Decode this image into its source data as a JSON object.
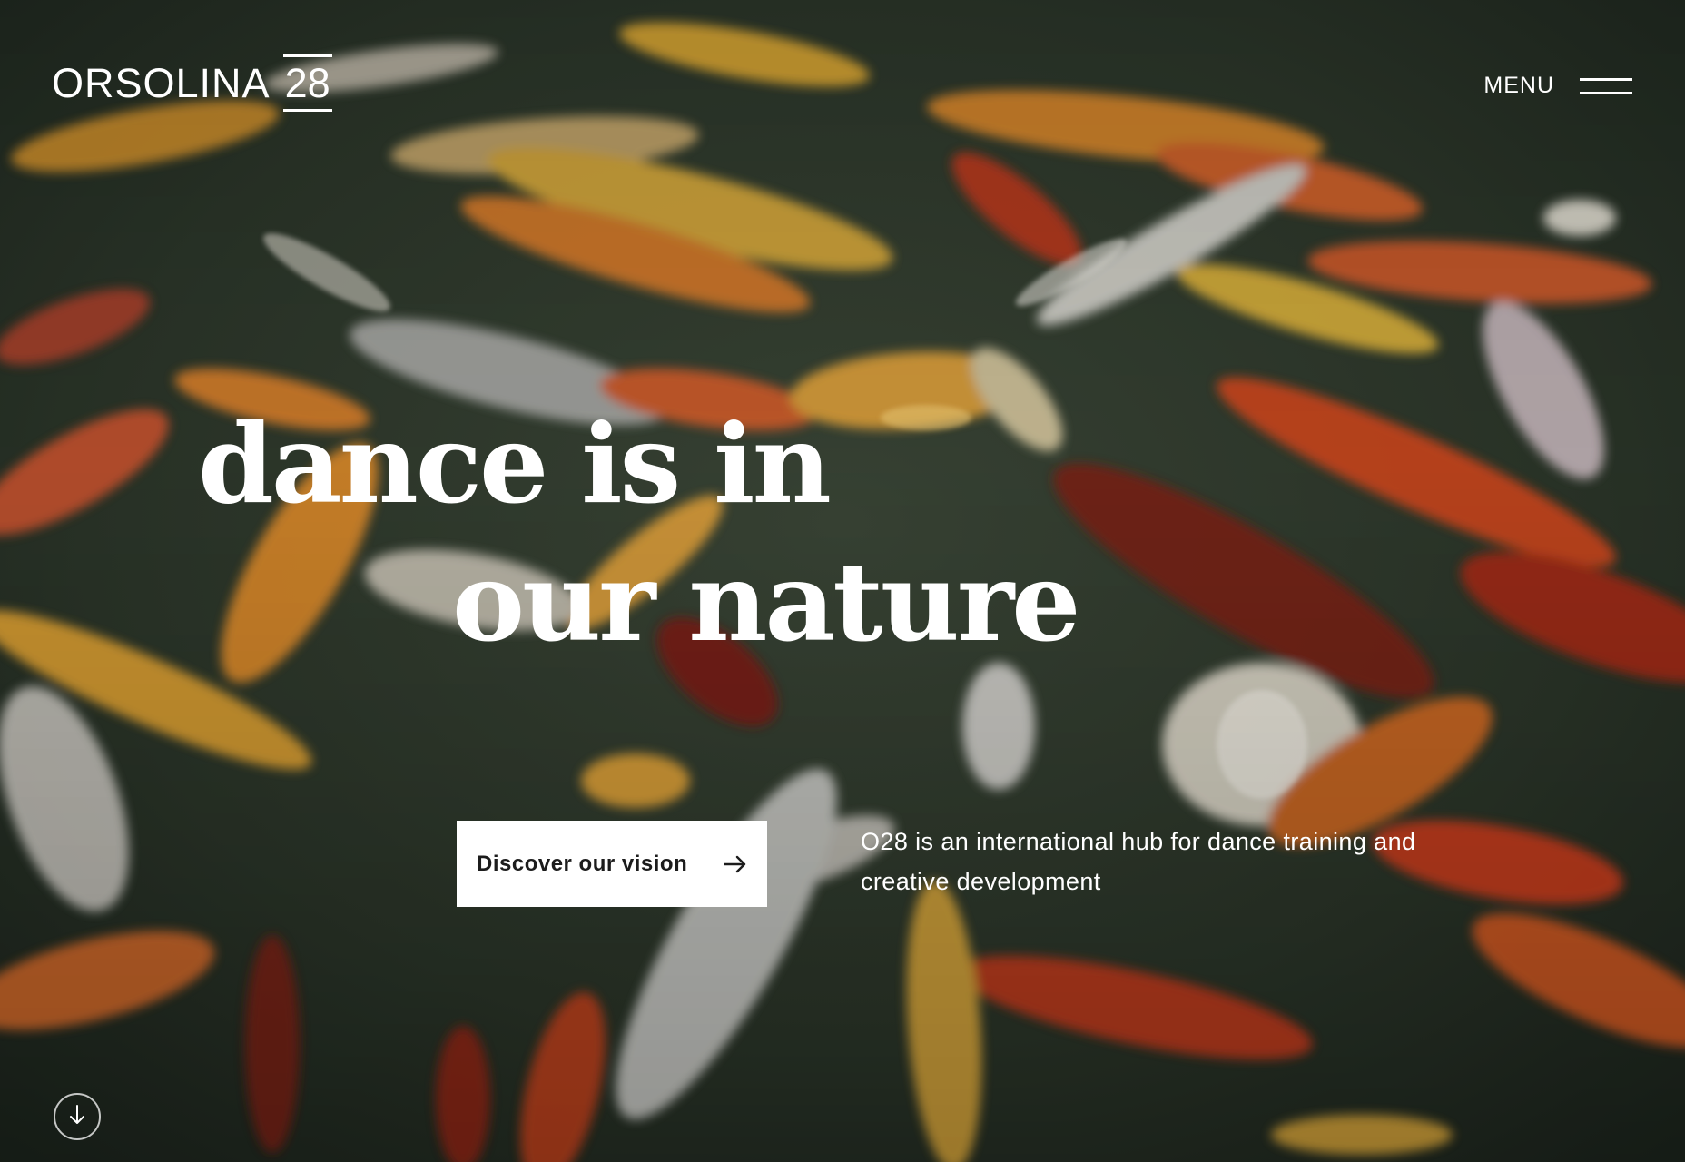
{
  "brand": {
    "name": "ORSOLINA",
    "number": "28"
  },
  "nav": {
    "menu_label": "MENU"
  },
  "hero": {
    "headline_line1": "dance is in",
    "headline_line2": "our nature",
    "cta_label": "Discover our vision",
    "description": "O28 is an international hub for dance training and creative development",
    "background": "koi-fish-pond",
    "icons": {
      "cta": "arrow-right-icon",
      "scroll": "arrow-down-icon",
      "menu": "hamburger-icon"
    }
  },
  "colors": {
    "text": "#ffffff",
    "button_bg": "#ffffff",
    "button_text": "#1c1c1c",
    "background": "#27322a"
  }
}
